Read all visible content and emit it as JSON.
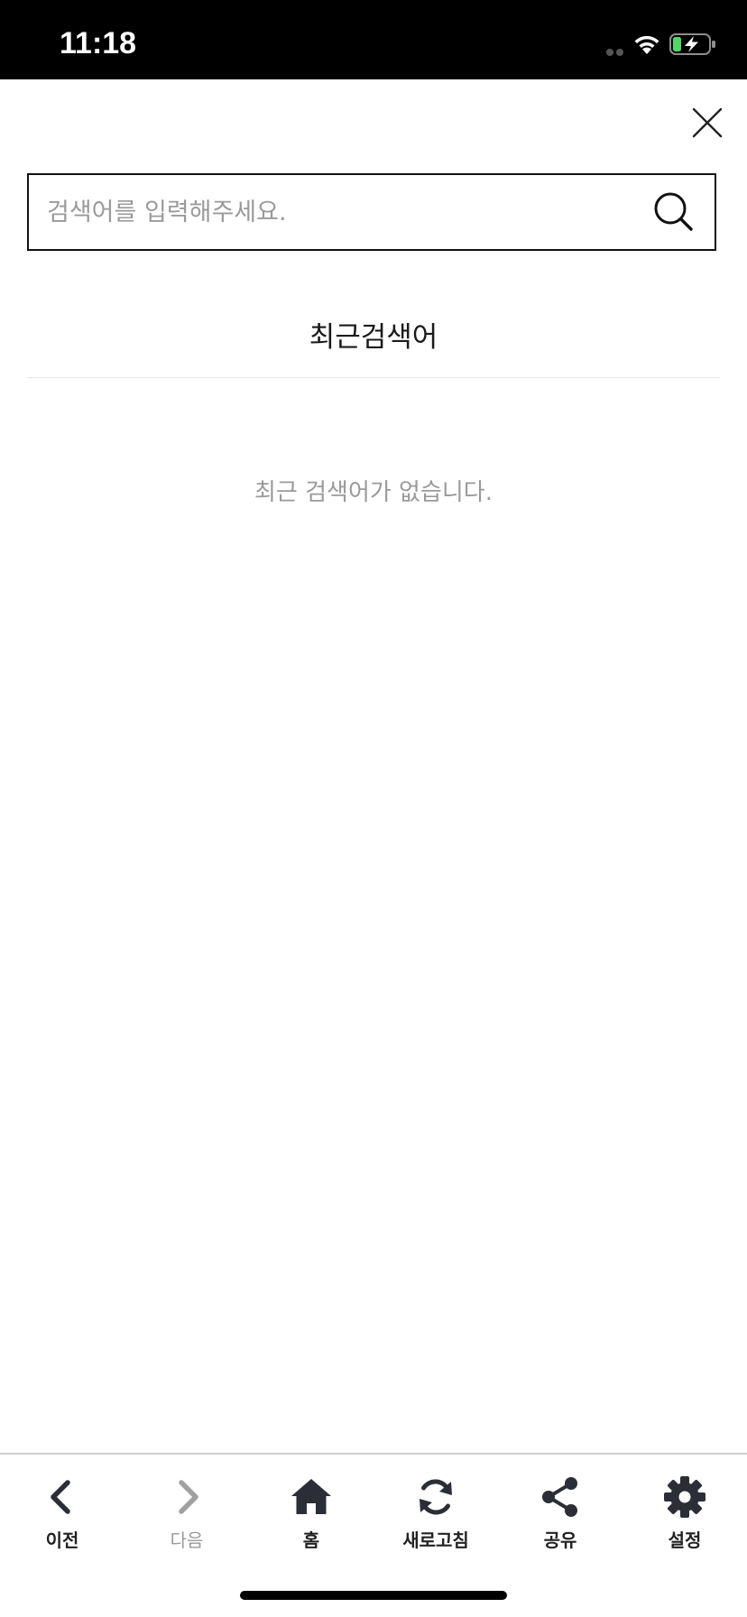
{
  "status_bar": {
    "time": "11:18",
    "icons": [
      "signal-icon",
      "wifi-icon",
      "battery-charging-icon"
    ],
    "battery_color": "#4cd964"
  },
  "search": {
    "placeholder": "검색어를 입력해주세요.",
    "value": "",
    "close_icon": "close-icon",
    "search_icon": "search-icon"
  },
  "recent": {
    "title": "최근검색어",
    "empty_message": "최근 검색어가 없습니다."
  },
  "toolbar": {
    "items": [
      {
        "label": "이전",
        "icon": "chevron-left-icon",
        "enabled": true
      },
      {
        "label": "다음",
        "icon": "chevron-right-icon",
        "enabled": false
      },
      {
        "label": "홈",
        "icon": "home-icon",
        "enabled": true
      },
      {
        "label": "새로고침",
        "icon": "refresh-icon",
        "enabled": true
      },
      {
        "label": "공유",
        "icon": "share-icon",
        "enabled": true
      },
      {
        "label": "설정",
        "icon": "gear-icon",
        "enabled": true
      }
    ]
  },
  "colors": {
    "text_primary": "#1a1a1a",
    "text_muted": "#9a9a9a",
    "icon_dark": "#2b2e36"
  }
}
